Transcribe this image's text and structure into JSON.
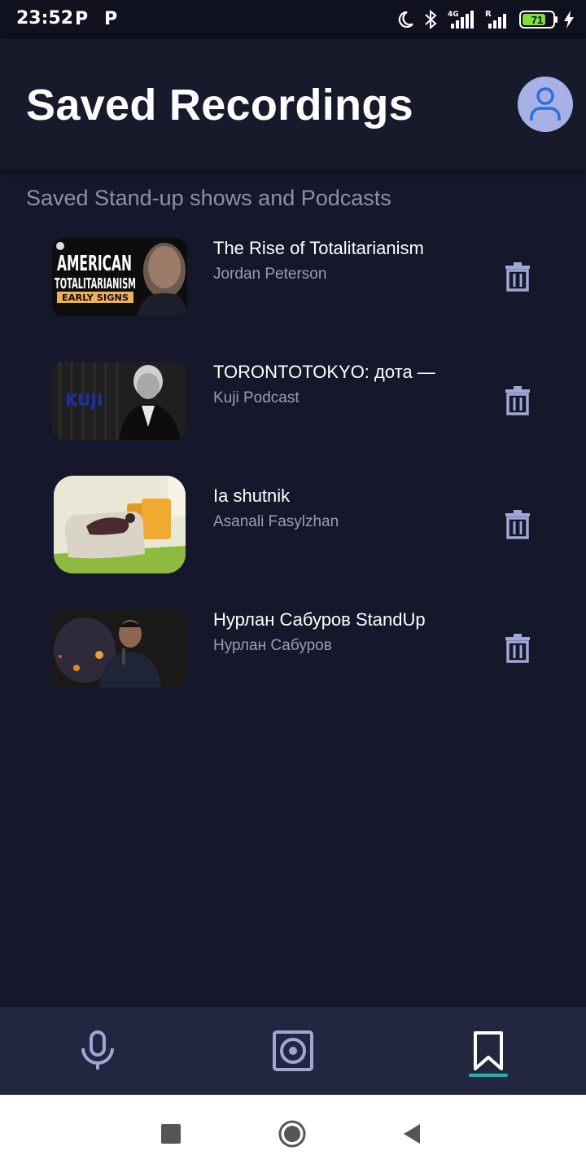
{
  "status_bar": {
    "time": "23:52",
    "app_icons": [
      "P",
      "P"
    ],
    "battery": "71",
    "icons": [
      "moon-icon",
      "bluetooth-icon",
      "signal-4g-icon",
      "signal-r-icon",
      "battery-icon",
      "charging-icon"
    ]
  },
  "header": {
    "title": "Saved Recordings",
    "avatar_icon": "user-icon"
  },
  "section_label": "Saved Stand-up shows and Podcasts",
  "recordings": [
    {
      "title": "The Rise of Totalitarianism",
      "author": "Jordan Peterson",
      "thumb_text": [
        "AMERICAN",
        "TOTALITARIANISM",
        "EARLY SIGNS"
      ]
    },
    {
      "title": "TORONTOTOKYO: дота —",
      "author": "Kuji Podcast",
      "thumb_text": [
        "KUJI"
      ]
    },
    {
      "title": "Ia shutnik",
      "author": "Asanali Fasylzhan",
      "thumb_text": []
    },
    {
      "title": "Нурлан Сабуров StandUp",
      "author": "Нурлан Сабуров",
      "thumb_text": []
    }
  ],
  "bottom_nav": {
    "items": [
      "microphone-icon",
      "recordings-disc-icon",
      "bookmark-icon"
    ],
    "active": "bookmark-icon"
  },
  "colors": {
    "background": "#15172a",
    "header": "#171a2b",
    "accent": "#1fb3ae",
    "icon": "#a0a6d6",
    "avatar": "#a8b1e6"
  }
}
